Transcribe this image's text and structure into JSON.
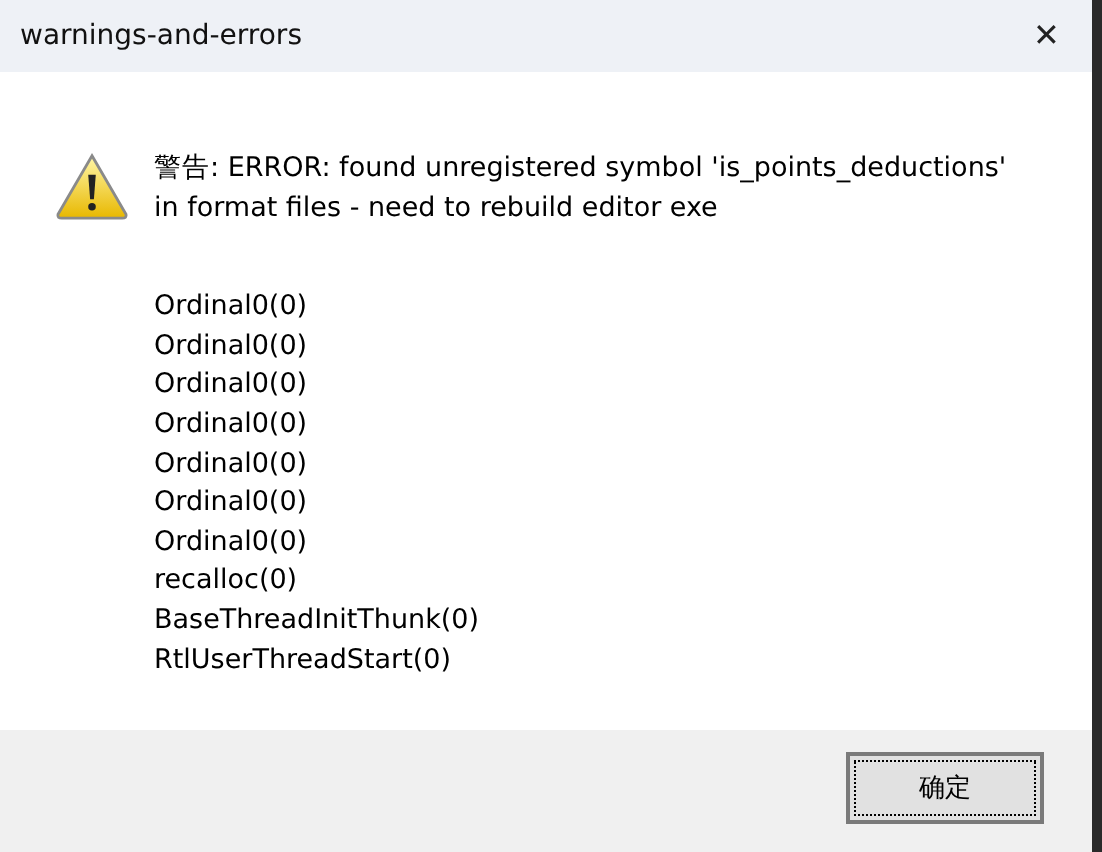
{
  "window": {
    "title": "warnings-and-errors",
    "close": "✕"
  },
  "message": [
    "警告: ERROR: found unregistered symbol 'is_points_deductions'",
    "in format files - need to rebuild editor exe"
  ],
  "stack": [
    "Ordinal0(0)",
    "Ordinal0(0)",
    "Ordinal0(0)",
    "Ordinal0(0)",
    "Ordinal0(0)",
    "Ordinal0(0)",
    "Ordinal0(0)",
    "recalloc(0)",
    "BaseThreadInitThunk(0)",
    "RtlUserThreadStart(0)"
  ],
  "buttons": [
    {
      "label": "确定",
      "selected": true
    }
  ]
}
